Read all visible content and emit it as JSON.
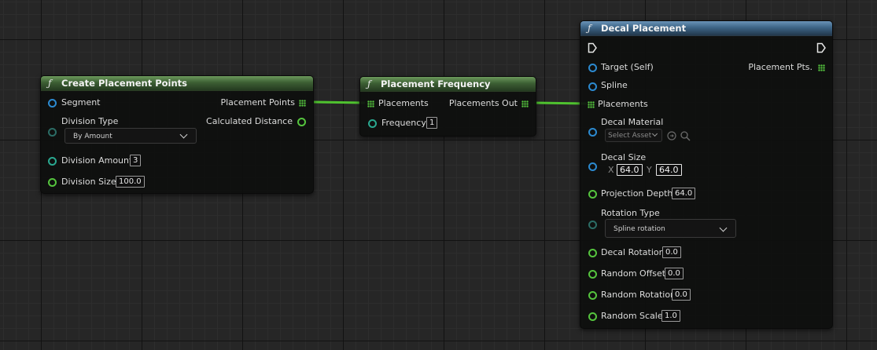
{
  "nodes": {
    "create": {
      "title": "Create Placement Points",
      "inputs": {
        "segment": "Segment",
        "division_type": "Division Type",
        "division_type_value": "By Amount",
        "division_amount": "Division Amount",
        "division_amount_value": "3",
        "division_size": "Division Size",
        "division_size_value": "100.0"
      },
      "outputs": {
        "placement_points": "Placement Points",
        "calculated_distance": "Calculated Distance"
      }
    },
    "frequency": {
      "title": "Placement Frequency",
      "inputs": {
        "placements": "Placements",
        "frequency": "Frequency",
        "frequency_value": "1"
      },
      "outputs": {
        "placements_out": "Placements Out"
      }
    },
    "decal": {
      "title": "Decal Placement",
      "inputs": {
        "target": "Target (Self)",
        "spline": "Spline",
        "placements": "Placements",
        "decal_material": "Decal Material",
        "select_asset": "Select Asset",
        "decal_size": "Decal Size",
        "x_label": "X",
        "x_value": "64.0",
        "y_label": "Y",
        "y_value": "64.0",
        "projection_depth": "Projection Depth",
        "projection_depth_value": "64.0",
        "rotation_type": "Rotation Type",
        "rotation_type_value": "Spline rotation",
        "decal_rotation": "Decal Rotation",
        "decal_rotation_value": "0.0",
        "random_offset": "Random Offset",
        "random_offset_value": "0.0",
        "random_rotation": "Random Rotation",
        "random_rotation_value": "0.0",
        "random_scale": "Random Scale",
        "random_scale_value": "1.0"
      },
      "outputs": {
        "placement_pts": "Placement Pts."
      }
    }
  },
  "icons": {
    "function": "function-icon",
    "exec": "exec-pin-icon",
    "array": "array-pin-icon",
    "browse": "browse-asset-icon",
    "search": "search-icon",
    "dropdown": "chevron-down-icon"
  },
  "colors": {
    "wire": "#4fc22f",
    "header_green": "#3d5f34",
    "header_blue": "#3d6486",
    "pin_blue": "#2c8ad0",
    "pin_teal": "#2aa890",
    "pin_green": "#55c43e"
  }
}
